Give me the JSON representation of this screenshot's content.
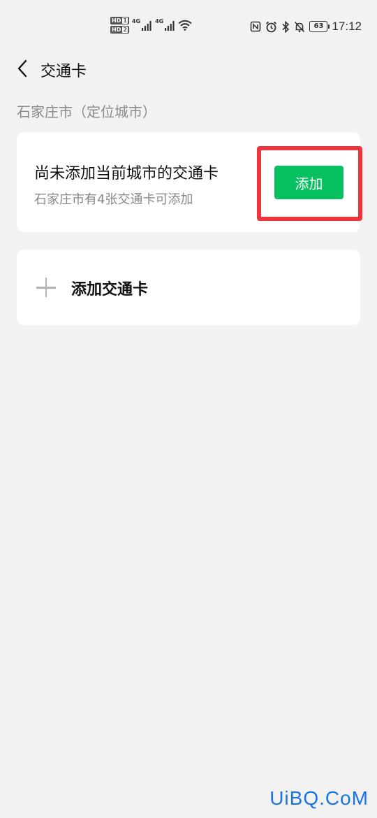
{
  "status_bar": {
    "sim1_badge": "HD",
    "sim1_num": "1",
    "sim2_badge": "HD",
    "sim2_num": "2",
    "network1": "4G",
    "network2": "4G",
    "battery": "63",
    "time": "17:12"
  },
  "header": {
    "title": "交通卡"
  },
  "city": {
    "label": "石家庄市（定位城市）"
  },
  "current_city_card": {
    "title": "尚未添加当前城市的交通卡",
    "subtitle": "石家庄市有4张交通卡可添加",
    "add_button_label": "添加"
  },
  "add_card": {
    "label": "添加交通卡"
  },
  "watermark": "UiBQ.CoM",
  "colors": {
    "accent_green": "#07c160",
    "highlight_red": "#f0343c",
    "background": "#f2f2f2"
  }
}
